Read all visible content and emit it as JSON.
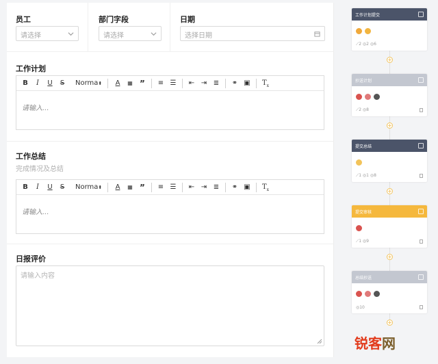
{
  "fields": {
    "employee": {
      "label": "员工",
      "placeholder": "请选择"
    },
    "department": {
      "label": "部门字段",
      "placeholder": "请选择"
    },
    "date": {
      "label": "日期",
      "placeholder": "选择日期"
    }
  },
  "toolbar": {
    "format": "Norma"
  },
  "work_plan": {
    "label": "工作计划",
    "placeholder": "请输入..."
  },
  "work_summary": {
    "label": "工作总结",
    "hint": "完成情况及总结",
    "placeholder": "请输入..."
  },
  "evaluation": {
    "label": "日报评价",
    "placeholder": "请输入内容"
  },
  "flow": {
    "cards": [
      {
        "title": "工作计划提交",
        "color": "#4b5469",
        "stats": "⟋2  ◎2  ◎6"
      },
      {
        "title": "抄送计划",
        "color": "#c3c7d0",
        "stats": "⟋2  ◎8"
      },
      {
        "title": "提交总结",
        "color": "#4b5469",
        "stats": "⟋1  ◎1  ◎8"
      },
      {
        "title": "提交审核",
        "color": "#f5b83d",
        "stats": "⟋1  ◎9"
      },
      {
        "title": "总结抄送",
        "color": "#c3c7d0",
        "stats": "◎10"
      }
    ]
  },
  "watermark": {
    "brand_a": "锐客",
    "brand_b": "网"
  }
}
